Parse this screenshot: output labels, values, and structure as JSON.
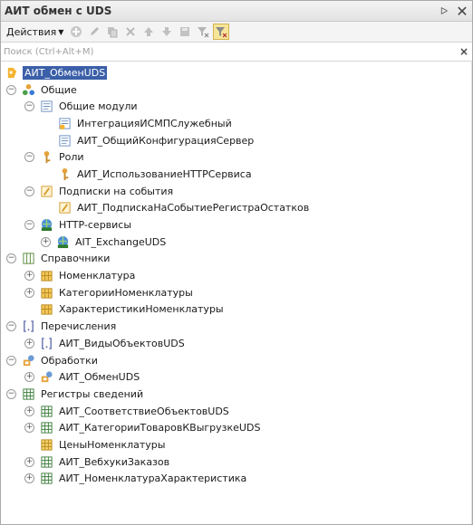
{
  "window": {
    "title": "АИТ обмен с UDS",
    "pin_icon": "pin-icon",
    "close_icon": "close-icon",
    "close_glyph": "✕",
    "pin_glyph": "ᐅ"
  },
  "toolbar": {
    "actions_label": "Действия",
    "icons": [
      "add-icon",
      "edit-icon",
      "copy-icon",
      "delete-icon",
      "move-up-icon",
      "move-down-icon",
      "save-icon",
      "filter-icon",
      "filter-active-icon"
    ]
  },
  "search": {
    "placeholder": "Поиск (Ctrl+Alt+M)",
    "value": "",
    "clear_glyph": "×"
  },
  "tree": [
    {
      "label": "АИТ_ОбменUDS",
      "icon": "subsystem-icon",
      "selected": true
    },
    {
      "label": "Общие",
      "icon": "common-icon"
    },
    {
      "label": "Общие модули",
      "icon": "module-icon"
    },
    {
      "label": "ИнтеграцияИСМПСлужебный",
      "icon": "module-icon"
    },
    {
      "label": "АИТ_ОбщийКонфигурацияСервер",
      "icon": "module-icon"
    },
    {
      "label": "Роли",
      "icon": "role-icon"
    },
    {
      "label": "АИТ_ИспользованиеHTTPСервиса",
      "icon": "role-icon"
    },
    {
      "label": "Подписки на события",
      "icon": "subscription-icon"
    },
    {
      "label": "АИТ_ПодпискаНаСобытиеРегистраОстатков",
      "icon": "subscription-icon"
    },
    {
      "label": "HTTP-сервисы",
      "icon": "http-service-icon"
    },
    {
      "label": "AIT_ExchangeUDS",
      "icon": "http-service-icon"
    },
    {
      "label": "Справочники",
      "icon": "catalogs-icon"
    },
    {
      "label": "Номенклатура",
      "icon": "catalog-icon"
    },
    {
      "label": "КатегорииНоменклатуры",
      "icon": "catalog-icon"
    },
    {
      "label": "ХарактеристикиНоменклатуры",
      "icon": "catalog-icon"
    },
    {
      "label": "Перечисления",
      "icon": "enum-icon"
    },
    {
      "label": "АИТ_ВидыОбъектовUDS",
      "icon": "enum-icon"
    },
    {
      "label": "Обработки",
      "icon": "dataprocessor-icon"
    },
    {
      "label": "АИТ_ОбменUDS",
      "icon": "dataprocessor-icon"
    },
    {
      "label": "Регистры сведений",
      "icon": "register-icon"
    },
    {
      "label": "АИТ_СоответствиеОбъектовUDS",
      "icon": "register-icon"
    },
    {
      "label": "АИТ_КатегорииТоваровКВыгрузкеUDS",
      "icon": "register-icon"
    },
    {
      "label": "ЦеныНоменклатуры",
      "icon": "register-icon"
    },
    {
      "label": "АИТ_ВебхукиЗаказов",
      "icon": "register-icon"
    },
    {
      "label": "АИТ_НоменклатураХарактеристика",
      "icon": "register-icon"
    }
  ]
}
